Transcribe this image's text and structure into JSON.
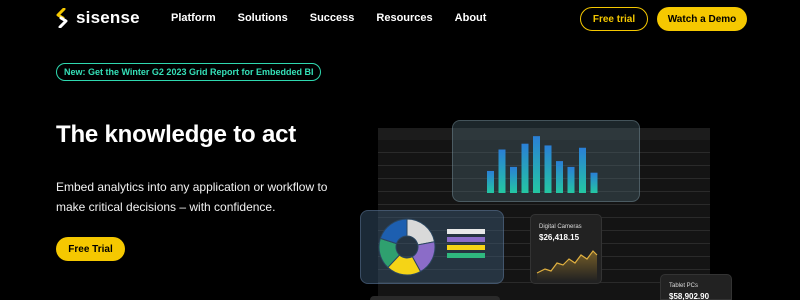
{
  "nav": {
    "logo": "sisense",
    "items": [
      "Platform",
      "Solutions",
      "Success",
      "Resources",
      "About"
    ],
    "free_trial": "Free trial",
    "watch_demo": "Watch a Demo"
  },
  "hero": {
    "announcement": "New: Get the Winter G2 2023 Grid Report for Embedded BI",
    "headline": "The knowledge to act",
    "subline": "Embed analytics into any application or workflow to make critical decisions – with confidence.",
    "cta": "Free Trial"
  },
  "dashboard": {
    "cameras_label": "Digital Cameras",
    "cameras_value": "$26,418.15",
    "tablets_label": "Tablet PCs",
    "tablets_value": "$58,902.90",
    "bar_values": [
      0.38,
      0.75,
      0.45,
      0.85,
      0.98,
      0.82,
      0.55,
      0.45,
      0.78,
      0.35
    ],
    "pie_segments": [
      0.22,
      0.2,
      0.2,
      0.18,
      0.2
    ],
    "colors": {
      "accent": "#f5c800",
      "teal": "#2fd9b0",
      "pie": [
        "#d9d9d9",
        "#8b6cc8",
        "#f5d416",
        "#2fa06f",
        "#1d5fb0"
      ]
    }
  }
}
